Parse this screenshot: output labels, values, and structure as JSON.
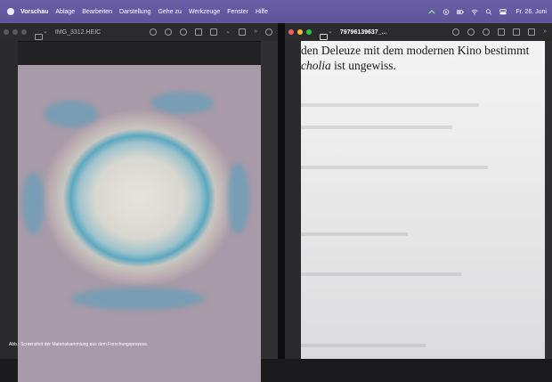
{
  "menubar": {
    "app": "Vorschau",
    "items": [
      "Ablage",
      "Bearbeiten",
      "Darstellung",
      "Gehe zu",
      "Werkzeuge",
      "Fenster",
      "Hilfe"
    ],
    "clock": "Fr. 26. Juni"
  },
  "left_window": {
    "title": "IMG_3312.HEIC",
    "caption": "Abb.: Screenshot der Materialsammlung aus dem Forschungsprozess."
  },
  "right_window": {
    "title": "79796139637_...",
    "text_line_1": "den Deleuze mit dem modernen Kino bestimmt",
    "text_line_2_italic": "cholia",
    "text_line_2_rest": " ist ungewiss."
  },
  "colors": {
    "menubar": "#5d549a",
    "traffic_red": "#fe5f57",
    "traffic_yellow": "#febc2e",
    "traffic_green": "#28c840"
  }
}
